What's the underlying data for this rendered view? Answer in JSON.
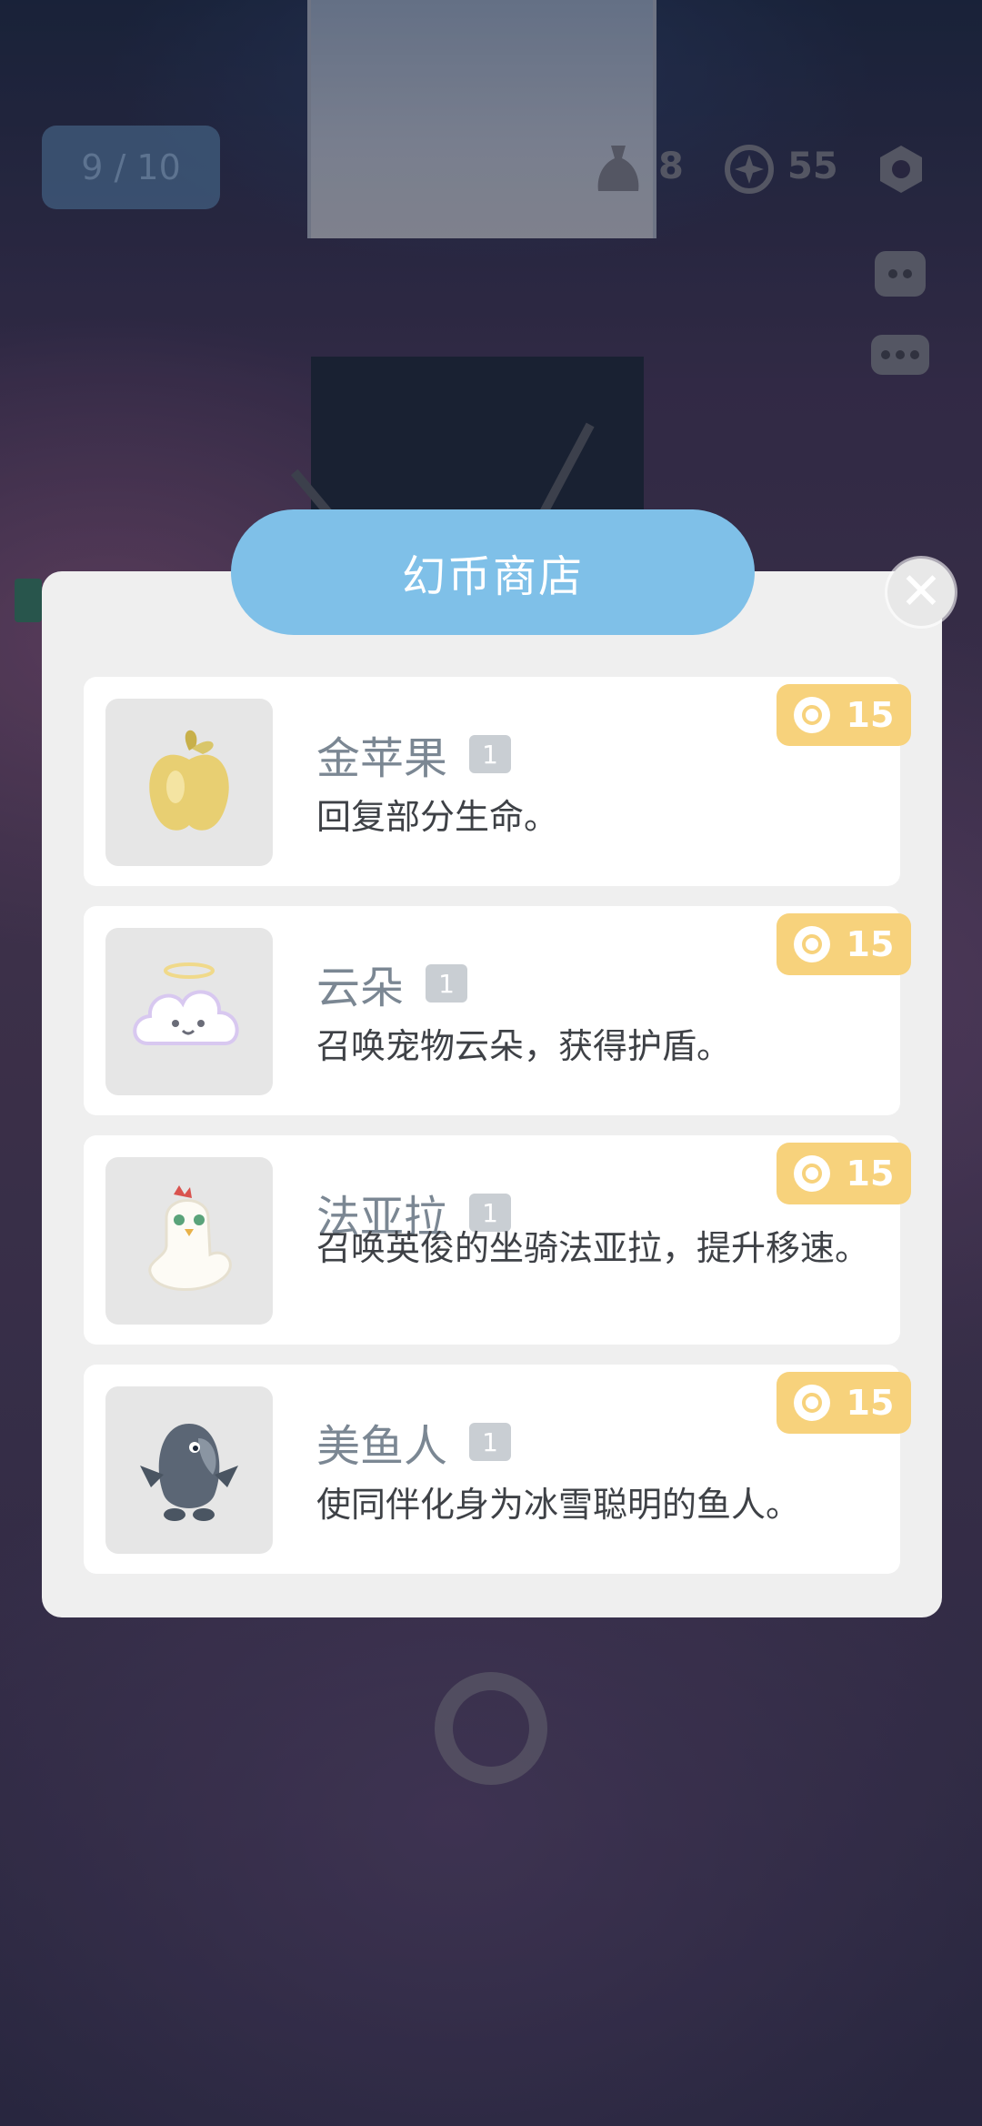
{
  "hud": {
    "progress": "9 / 10",
    "bag_count": "8",
    "coin_count": "55"
  },
  "shop": {
    "title": "幻币商店",
    "items": [
      {
        "name": "金苹果",
        "qty": "1",
        "desc": "回复部分生命。",
        "price": "15",
        "icon": "golden-apple-icon"
      },
      {
        "name": "云朵",
        "qty": "1",
        "desc": "召唤宠物云朵，获得护盾。",
        "price": "15",
        "icon": "cloud-pet-icon"
      },
      {
        "name": "法亚拉",
        "qty": "1",
        "desc": "召唤英俊的坐骑法亚拉，提升移速。",
        "price": "15",
        "icon": "chicken-mount-icon"
      },
      {
        "name": "美鱼人",
        "qty": "1",
        "desc": "使同伴化身为冰雪聪明的鱼人。",
        "price": "15",
        "icon": "fish-person-icon"
      }
    ]
  },
  "colors": {
    "title_bg": "#7fc0e8",
    "price_bg": "#f7d27c",
    "dialog_bg": "#efefef"
  }
}
